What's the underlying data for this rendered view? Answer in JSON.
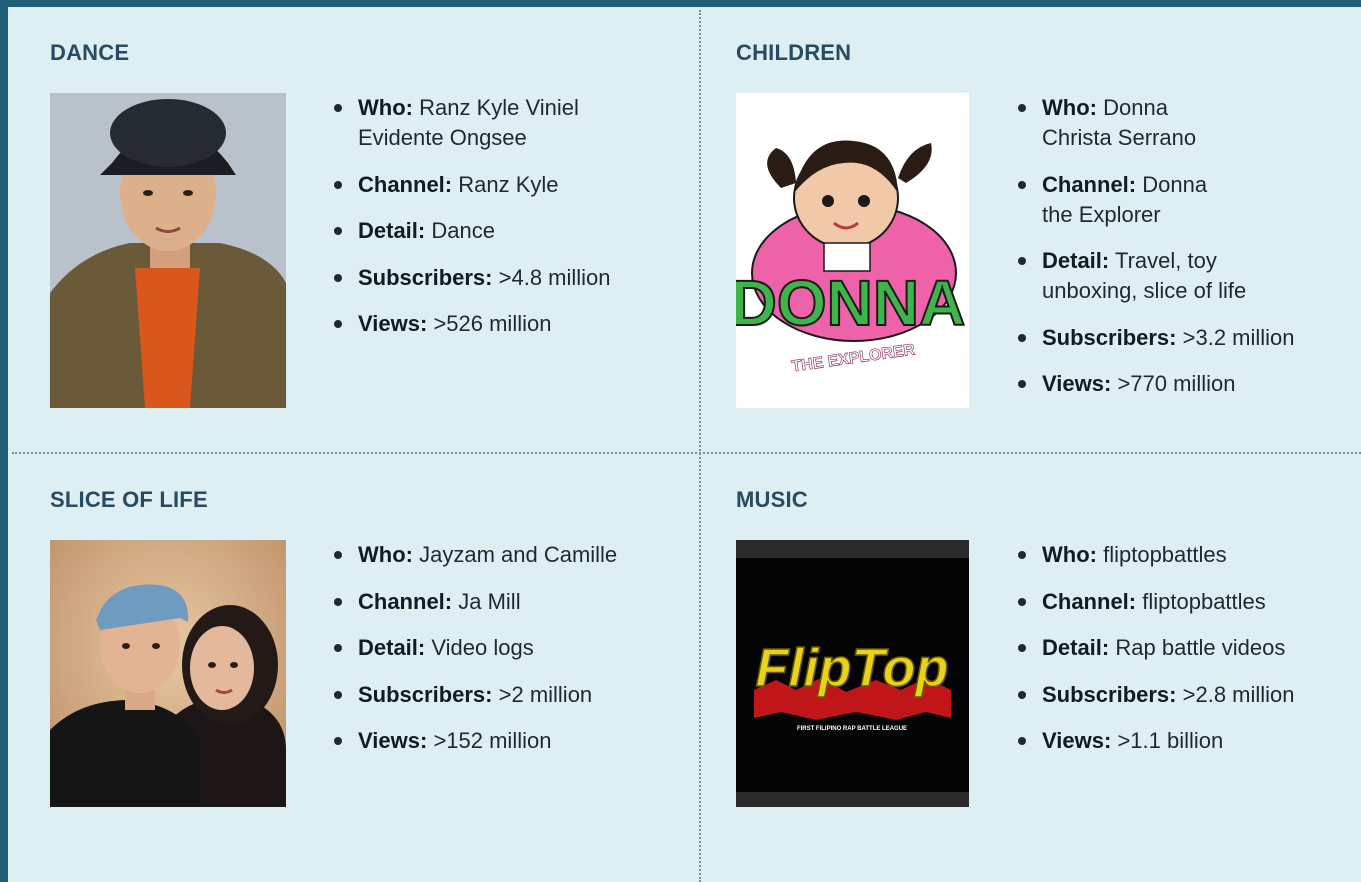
{
  "sections": [
    {
      "title": "DANCE",
      "facts": [
        {
          "label": "Who:",
          "value": "Ranz Kyle Viniel Evidente Ongsee"
        },
        {
          "label": "Channel:",
          "value": "Ranz Kyle"
        },
        {
          "label": "Detail:",
          "value": "Dance"
        },
        {
          "label": "Subscribers:",
          "value": ">4.8 million"
        },
        {
          "label": "Views:",
          "value": ">526 million"
        }
      ]
    },
    {
      "title": "CHILDREN",
      "facts": [
        {
          "label": "Who:",
          "value": "Donna Christa Serrano"
        },
        {
          "label": "Channel:",
          "value": "Donna the Explorer"
        },
        {
          "label": "Detail:",
          "value": "Travel, toy unboxing, slice of life"
        },
        {
          "label": "Subscribers:",
          "value": ">3.2 million"
        },
        {
          "label": "Views:",
          "value": ">770 million"
        }
      ],
      "logo": {
        "word": "DONNA",
        "tagline": "THE EXPLORER"
      }
    },
    {
      "title": "SLICE OF LIFE",
      "facts": [
        {
          "label": "Who:",
          "value": "Jayzam and Camille"
        },
        {
          "label": "Channel:",
          "value": "Ja Mill"
        },
        {
          "label": "Detail:",
          "value": "Video logs"
        },
        {
          "label": "Subscribers:",
          "value": ">2 million"
        },
        {
          "label": "Views:",
          "value": ">152 million"
        }
      ]
    },
    {
      "title": "MUSIC",
      "facts": [
        {
          "label": "Who:",
          "value": "fliptopbattles"
        },
        {
          "label": "Channel:",
          "value": "fliptopbattles"
        },
        {
          "label": "Detail:",
          "value": "Rap battle videos"
        },
        {
          "label": "Subscribers:",
          "value": ">2.8 million"
        },
        {
          "label": "Views:",
          "value": ">1.1 billion"
        }
      ],
      "logo": {
        "word": "FlipTop",
        "tagline": "FIRST FILIPINO RAP BATTLE LEAGUE"
      }
    }
  ],
  "colors": {
    "frame": "#1f5f78",
    "panel": "#ddeff2",
    "heading": "#284b62",
    "text": "#1b2a33"
  }
}
